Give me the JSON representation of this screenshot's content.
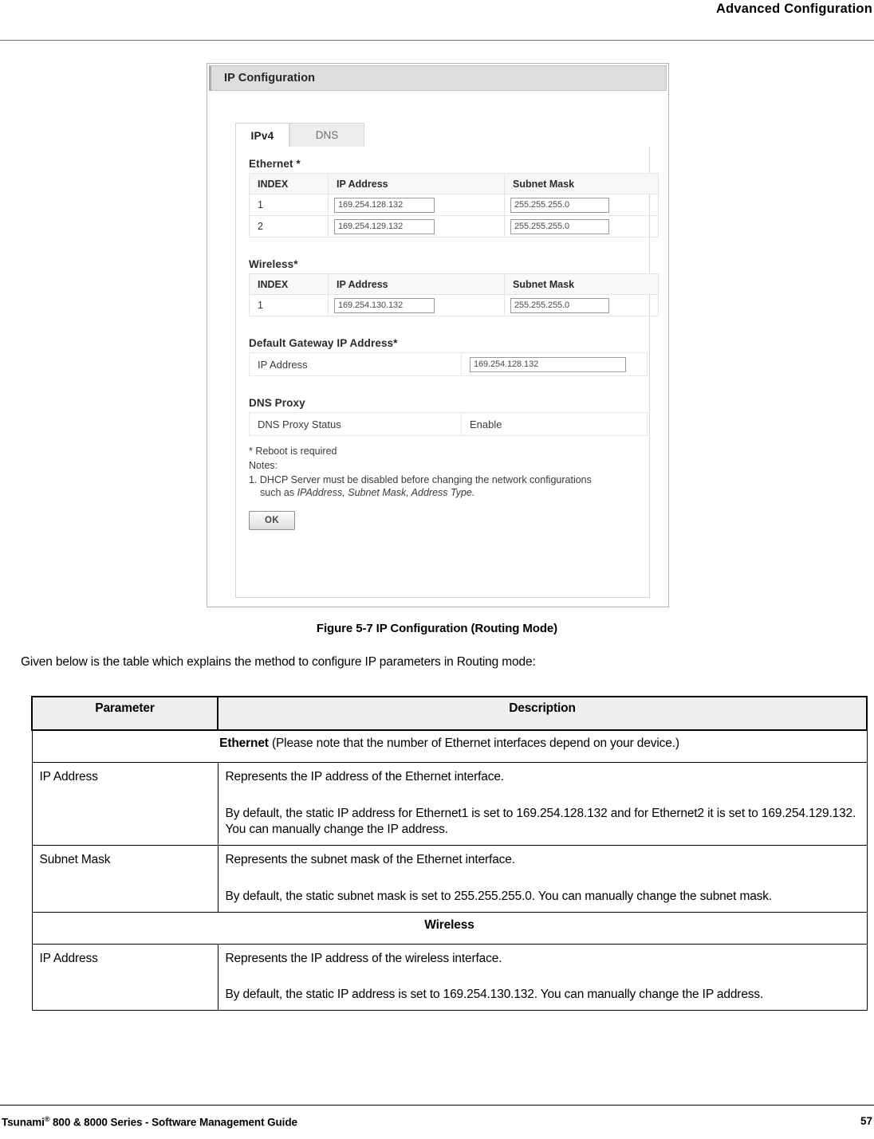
{
  "header": {
    "title": "Advanced Configuration"
  },
  "figure": {
    "panel_title": "IP Configuration",
    "tabs": [
      {
        "label": "IPv4",
        "active": true
      },
      {
        "label": "DNS",
        "active": false
      }
    ],
    "ethernet": {
      "section_label": "Ethernet *",
      "columns": [
        "INDEX",
        "IP Address",
        "Subnet Mask"
      ],
      "rows": [
        {
          "index": "1",
          "ip": "169.254.128.132",
          "mask": "255.255.255.0"
        },
        {
          "index": "2",
          "ip": "169.254.129.132",
          "mask": "255.255.255.0"
        }
      ]
    },
    "wireless": {
      "section_label": "Wireless*",
      "columns": [
        "INDEX",
        "IP Address",
        "Subnet Mask"
      ],
      "rows": [
        {
          "index": "1",
          "ip": "169.254.130.132",
          "mask": "255.255.255.0"
        }
      ]
    },
    "gateway": {
      "section_label": "Default Gateway IP Address*",
      "key": "IP Address",
      "value": "169.254.128.132"
    },
    "dns_proxy": {
      "section_label": "DNS Proxy",
      "key": "DNS Proxy Status",
      "value": "Enable"
    },
    "notes": {
      "reboot": "* Reboot is required",
      "title": "Notes:",
      "item1_line1": "1. DHCP Server must be disabled before changing the network configurations",
      "item1_line2_prefix": "such as ",
      "item1_line2_italic": "IPAddress, Subnet Mask, Address Type."
    },
    "ok_button": "OK",
    "caption": "Figure 5-7 IP Configuration (Routing Mode)"
  },
  "intro": {
    "text": "Given below is the table which explains the method to configure IP parameters in Routing mode:"
  },
  "param_table": {
    "headers": [
      "Parameter",
      "Description"
    ],
    "section_ethernet_bold": "Ethernet",
    "section_ethernet_rest": " (Please note that the number of Ethernet interfaces depend on your device.)",
    "section_wireless": "Wireless",
    "rows": [
      {
        "parameter": "IP Address",
        "desc_p1": "Represents the IP address of the Ethernet interface.",
        "desc_p2": "By default, the static IP address for Ethernet1 is set to 169.254.128.132 and for Ethernet2 it is set to 169.254.129.132. You can manually change the IP address."
      },
      {
        "parameter": "Subnet Mask",
        "desc_p1": "Represents the subnet mask of the Ethernet interface.",
        "desc_p2": "By default, the static subnet mask is set to 255.255.255.0. You can manually change the subnet mask."
      },
      {
        "parameter": "IP Address",
        "desc_p1": "Represents the IP address of the wireless interface.",
        "desc_p2": "By default, the static IP address is set to 169.254.130.132. You can manually change the IP address."
      }
    ]
  },
  "footer": {
    "guide_prefix": "Tsunami",
    "guide_sup": "®",
    "guide_rest": " 800 & 8000 Series - Software Management Guide",
    "page_number": "57"
  }
}
